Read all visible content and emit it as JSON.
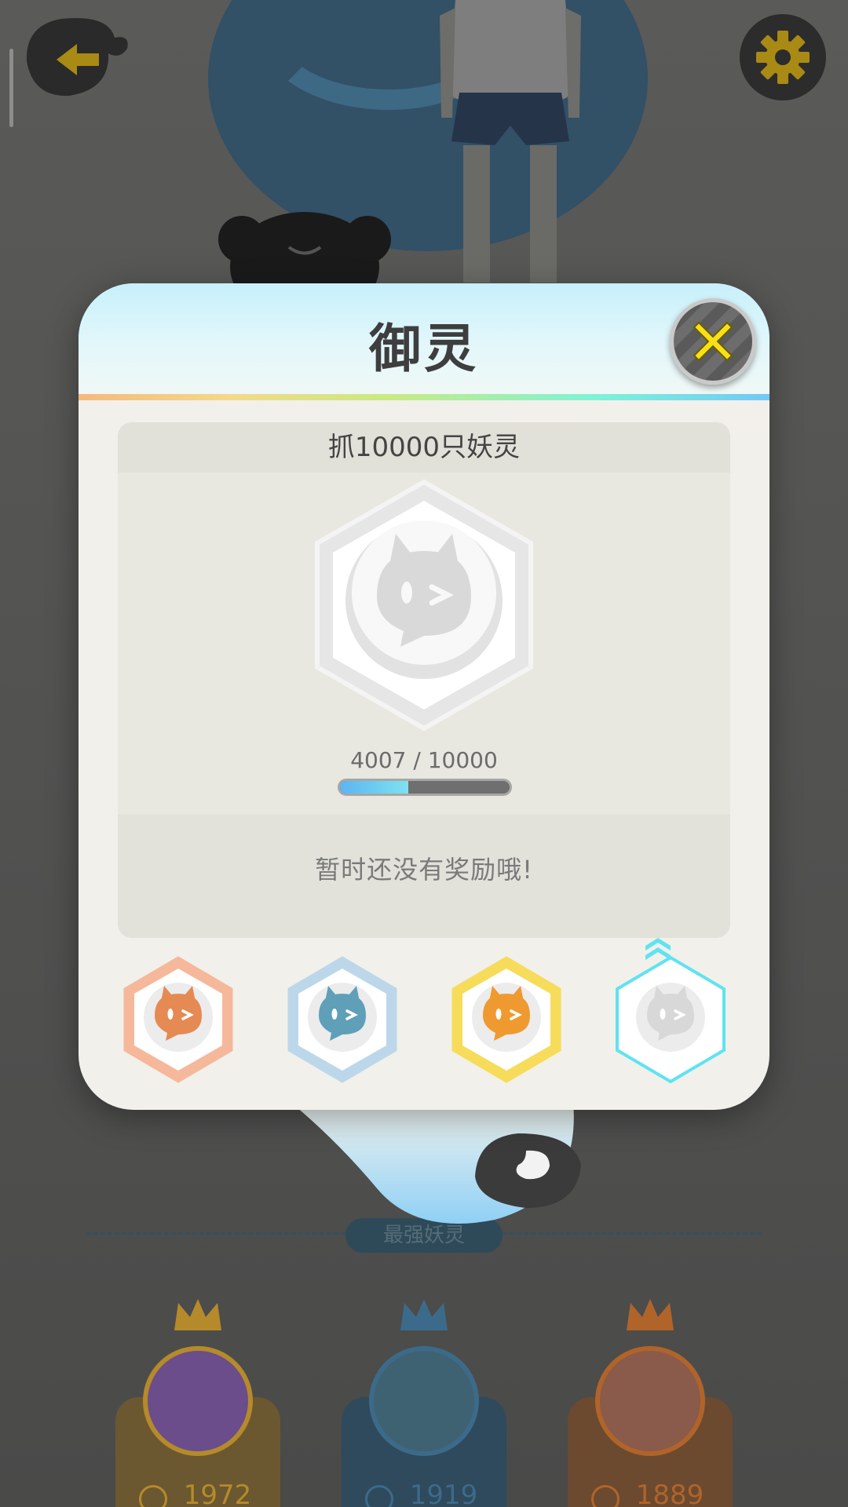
{
  "background": {
    "section_title": "最强妖灵",
    "leaderboard": [
      {
        "score": "1972",
        "accent": "#b58a2a",
        "pedestal": "#6b5830",
        "avatar": "#6a4d8a"
      },
      {
        "score": "1919",
        "accent": "#3c6a8a",
        "pedestal": "#2e4a5c",
        "avatar": "#3f6272"
      },
      {
        "score": "1889",
        "accent": "#b0642a",
        "pedestal": "#6b4a30",
        "avatar": "#8a5a4a"
      }
    ]
  },
  "modal": {
    "title": "御灵",
    "task": {
      "title": "抓10000只妖灵",
      "progress_text": "4007 / 10000",
      "progress_current": 4007,
      "progress_total": 10000
    },
    "reward_text": "暂时还没有奖励哦!",
    "tiers": [
      {
        "name": "bronze",
        "color": "#e58a52",
        "rim": "#f6b89b",
        "selected": false
      },
      {
        "name": "silver",
        "color": "#5fa0b8",
        "rim": "#bcd7ea",
        "selected": false
      },
      {
        "name": "gold",
        "color": "#ef9a30",
        "rim": "#f6dc5a",
        "selected": false
      },
      {
        "name": "platinum",
        "color": "#d8d8d8",
        "rim": "#5fe3f2",
        "selected": true
      }
    ]
  },
  "icons": {
    "back": "back-arrow-icon",
    "settings": "gear-icon",
    "close": "close-icon",
    "upgrade": "chevron-up-icon"
  }
}
